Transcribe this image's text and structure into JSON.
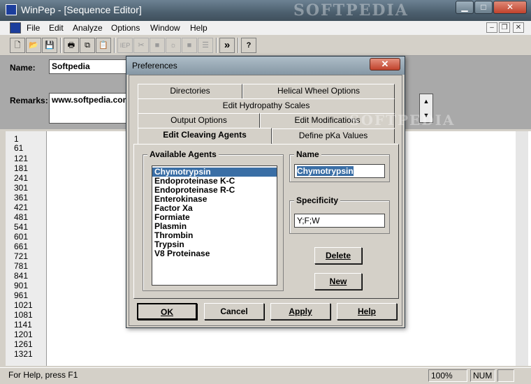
{
  "window": {
    "title": "WinPep - [Sequence Editor]"
  },
  "menu": {
    "items": [
      "File",
      "Edit",
      "Analyze",
      "Options",
      "Window",
      "Help"
    ]
  },
  "toolbar": {
    "buttons": [
      {
        "icon": "new-doc-icon",
        "glyph": "🗋"
      },
      {
        "icon": "open-folder-icon",
        "glyph": "📂"
      },
      {
        "icon": "save-icon",
        "glyph": "💾"
      },
      {
        "icon": "print-icon",
        "glyph": "🖶"
      },
      {
        "icon": "copy-icon",
        "glyph": "⧉"
      },
      {
        "icon": "paste-icon",
        "glyph": "📋"
      },
      {
        "icon": "iep-icon",
        "glyph": "IEP"
      },
      {
        "icon": "cut-icon",
        "glyph": "✂"
      },
      {
        "icon": "block-icon",
        "glyph": "■"
      },
      {
        "icon": "sun-icon",
        "glyph": "☼"
      },
      {
        "icon": "stop-icon",
        "glyph": "■"
      },
      {
        "icon": "lines-icon",
        "glyph": "☰"
      },
      {
        "icon": "fast-forward-icon",
        "glyph": "»"
      },
      {
        "icon": "help-icon",
        "glyph": "?"
      }
    ]
  },
  "sequence": {
    "name_label": "Name:",
    "name_value": "Softpedia",
    "remarks_label": "Remarks:",
    "remarks_value": "www.softpedia.com",
    "ruler": [
      "1",
      "61",
      "121",
      "181",
      "241",
      "301",
      "361",
      "421",
      "481",
      "541",
      "601",
      "661",
      "721",
      "781",
      "841",
      "901",
      "961",
      "1021",
      "1081",
      "1141",
      "1201",
      "1261",
      "1321"
    ]
  },
  "status": {
    "help_text": "For Help, press F1",
    "zoom": "100%",
    "num": "NUM"
  },
  "watermark": "SOFTPEDIA",
  "dialog": {
    "title": "Preferences",
    "tabs_row1": [
      "Directories",
      "Helical Wheel Options"
    ],
    "tabs_row2": [
      "Edit Hydropathy Scales"
    ],
    "tabs_row3": [
      "Output Options",
      "Edit Modifications"
    ],
    "tabs_row4": [
      "Edit Cleaving Agents",
      "Define pKa Values"
    ],
    "agents_title": "Available Agents",
    "agents": [
      "Chymotrypsin",
      "Endoproteinase K-C",
      "Endoproteinase R-C",
      "Enterokinase",
      "Factor Xa",
      "Formiate",
      "Plasmin",
      "Thrombin",
      "Trypsin",
      "V8 Proteinase"
    ],
    "name_title": "Name",
    "name_value": "Chymotrypsin",
    "specificity_title": "Specificity",
    "specificity_value": "Y;F;W",
    "delete_label": "Delete",
    "new_label": "New",
    "ok_label": "OK",
    "cancel_label": "Cancel",
    "apply_label": "Apply",
    "help_label": "Help"
  }
}
